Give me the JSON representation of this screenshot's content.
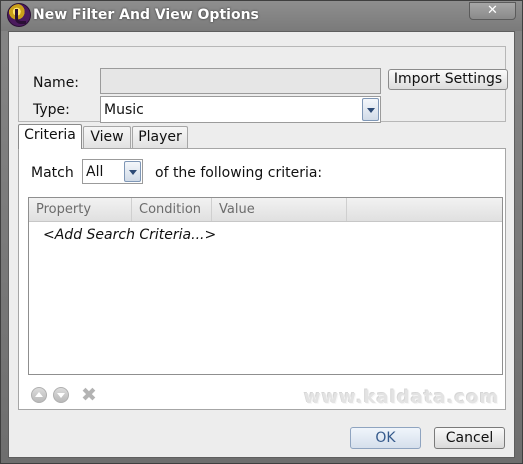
{
  "window": {
    "title": "New Filter And View Options",
    "close_symbol": "✕",
    "app_icon": "app-logo-icon"
  },
  "general": {
    "name_label": "Name:",
    "name_value": "",
    "type_label": "Type:",
    "type_value": "Music",
    "import_button": "Import Settings"
  },
  "tabs": [
    {
      "label": "Criteria",
      "active": true
    },
    {
      "label": "View",
      "active": false
    },
    {
      "label": "Player",
      "active": false
    }
  ],
  "criteria": {
    "match_label": "Match",
    "match_value": "All",
    "after_label": "of the following criteria:",
    "columns": [
      "Property",
      "Condition",
      "Value"
    ],
    "add_row": "<Add Search Criteria...>"
  },
  "watermark": "www.kaldata.com",
  "buttons": {
    "ok": "OK",
    "cancel": "Cancel"
  }
}
